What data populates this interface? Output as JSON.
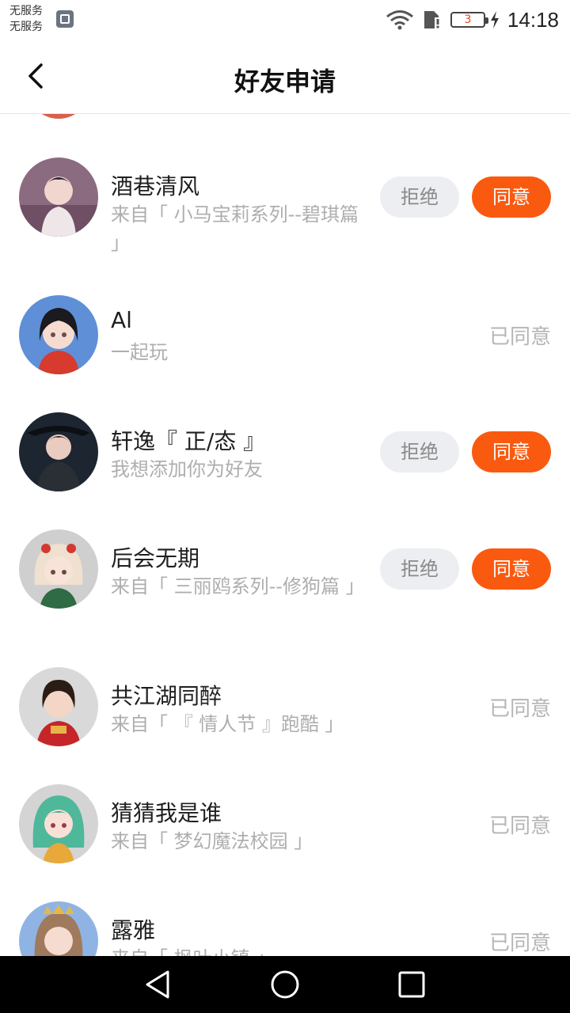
{
  "status_bar": {
    "carrier_line1": "无服务",
    "carrier_line2": "无服务",
    "battery_level": "3",
    "time": "14:18"
  },
  "header": {
    "title": "好友申请"
  },
  "actions": {
    "reject_label": "拒绝",
    "agree_label": "同意",
    "agreed_label": "已同意"
  },
  "requests": [
    {
      "name": "酒巷清风",
      "note": "来自「 小马宝莉系列--碧琪篇 」",
      "status": "pending"
    },
    {
      "name": "Al",
      "note": "一起玩",
      "status": "agreed"
    },
    {
      "name": "轩逸『 正/态 』",
      "note": "我想添加你为好友",
      "status": "pending"
    },
    {
      "name": "后会无期",
      "note": "来自「 三丽鸥系列--修狗篇 」",
      "status": "pending"
    },
    {
      "name": "共江湖同醉",
      "note": "来自「 『 情人节 』跑酷 」",
      "status": "agreed"
    },
    {
      "name": "猜猜我是谁",
      "note": "来自「 梦幻魔法校园 」",
      "status": "agreed"
    },
    {
      "name": "露雅",
      "note": "来自「 枫叶小镇 」",
      "status": "agreed"
    }
  ],
  "colors": {
    "accent": "#fa5a0f",
    "reject_bg": "#eceef2",
    "muted_text": "#aeaeae"
  }
}
